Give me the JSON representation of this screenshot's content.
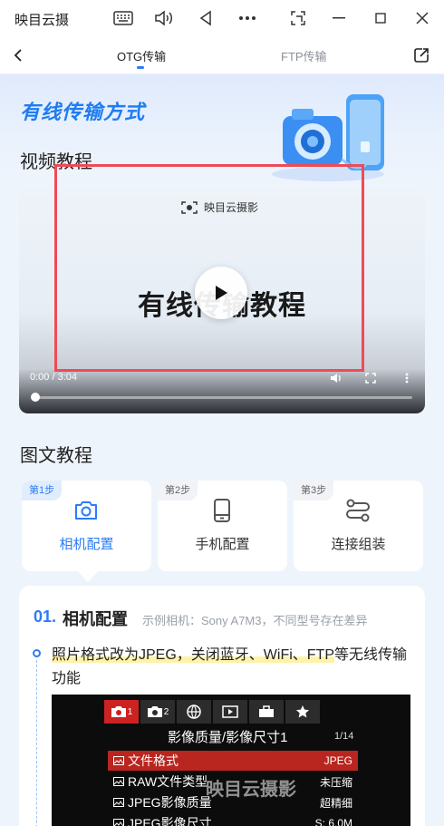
{
  "window": {
    "title": "映目云摄",
    "icons": [
      "keyboard-icon",
      "volume-icon",
      "back-triangle-icon",
      "more-icon",
      "screenshot-icon",
      "minimize-icon",
      "maximize-icon",
      "close-icon"
    ]
  },
  "header": {
    "tabs": [
      {
        "label": "OTG传输",
        "active": true
      },
      {
        "label": "FTP传输",
        "active": false
      }
    ]
  },
  "hero": {
    "title": "有线传输方式"
  },
  "video_section": {
    "title": "视频教程",
    "brand": "映目云摄影",
    "video_title": "有线传输教程",
    "time": "0:00 / 3:04",
    "progress": 0
  },
  "graphic_section": {
    "title": "图文教程",
    "steps": [
      {
        "badge": "第1步",
        "label": "相机配置",
        "icon": "camera-icon",
        "active": true
      },
      {
        "badge": "第2步",
        "label": "手机配置",
        "icon": "phone-icon",
        "active": false
      },
      {
        "badge": "第3步",
        "label": "连接组装",
        "icon": "connect-icon",
        "active": false
      }
    ]
  },
  "detail": {
    "number": "01.",
    "title": "相机配置",
    "subtitle": "示例相机：Sony A7M3，不同型号存在差异",
    "desc_highlight": "照片格式改为JPEG，关闭蓝牙、WiFi、FTP",
    "desc_rest": "等无线传输功能"
  },
  "camera_menu": {
    "tabs": [
      "1",
      "2"
    ],
    "title": "影像质量/影像尺寸1",
    "page": "1/14",
    "rows": [
      {
        "label": "文件格式",
        "value": "JPEG",
        "selected": true
      },
      {
        "label": "RAW文件类型",
        "value": "未压缩",
        "selected": false
      },
      {
        "label": "JPEG影像质量",
        "value": "超精细",
        "selected": false
      },
      {
        "label": "JPEG影像尺寸",
        "value": "S: 6.0M",
        "selected": false
      }
    ],
    "watermark": "映目云摄影"
  },
  "colors": {
    "accent": "#2b7cf5",
    "highlight_box": "#ee4b57"
  }
}
